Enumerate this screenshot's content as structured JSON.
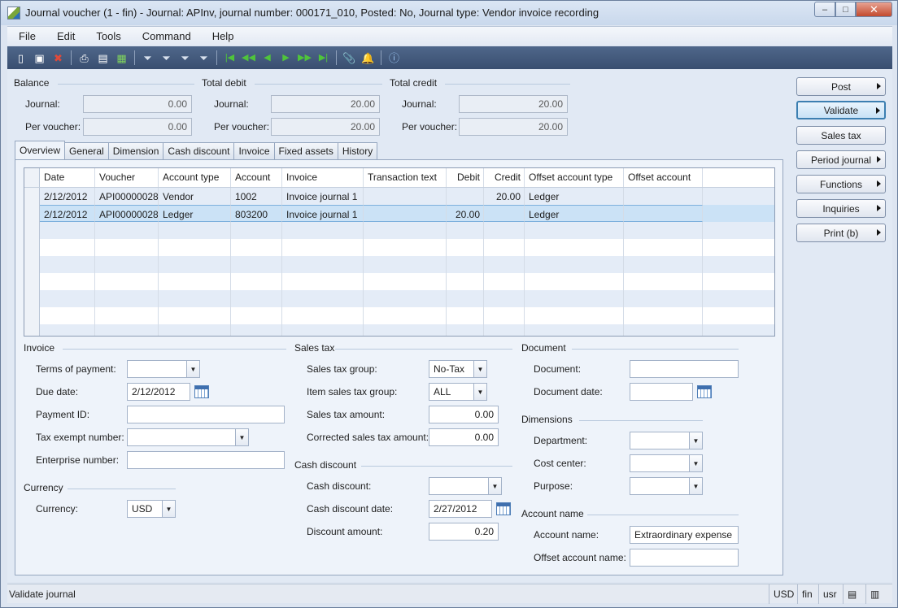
{
  "window": {
    "title": "Journal voucher (1 - fin) - Journal: APInv, journal number: 000171_010, Posted: No, Journal type: Vendor invoice recording",
    "min": "–",
    "max": "□",
    "close": "✕"
  },
  "menu": [
    "File",
    "Edit",
    "Tools",
    "Command",
    "Help"
  ],
  "toolbar_icons": [
    "new-icon",
    "save-icon",
    "delete-icon",
    "print-icon",
    "print-preview-icon",
    "export-excel-icon",
    "filter-by-selection-icon",
    "filter-by-form-icon",
    "advanced-filter-icon",
    "remove-filter-icon",
    "first-record-icon",
    "previous-page-icon",
    "previous-record-icon",
    "next-record-icon",
    "next-page-icon",
    "last-record-icon",
    "document-handling-icon",
    "alert-icon",
    "help-icon"
  ],
  "balance": {
    "balance_head": "Balance",
    "debit_head": "Total debit",
    "credit_head": "Total credit",
    "journal_label": "Journal:",
    "voucher_label": "Per voucher:",
    "balance_journal": "0.00",
    "balance_voucher": "0.00",
    "debit_journal": "20.00",
    "debit_voucher": "20.00",
    "credit_journal": "20.00",
    "credit_voucher": "20.00"
  },
  "tabs": [
    "Overview",
    "General",
    "Dimension",
    "Cash discount",
    "Invoice",
    "Fixed assets",
    "History"
  ],
  "active_tab": "Overview",
  "grid": {
    "columns": [
      "Date",
      "Voucher",
      "Account type",
      "Account",
      "Invoice",
      "Transaction text",
      "Debit",
      "Credit",
      "Offset account type",
      "Offset account"
    ],
    "rows": [
      {
        "date": "2/12/2012",
        "voucher": "API00000028",
        "account_type": "Vendor",
        "account": "1002",
        "invoice": "Invoice journal 1",
        "text": "",
        "debit": "",
        "credit": "20.00",
        "offset_type": "Ledger",
        "offset_account": ""
      },
      {
        "date": "2/12/2012",
        "voucher": "API00000028",
        "account_type": "Ledger",
        "account": "803200",
        "invoice": "Invoice journal 1",
        "text": "",
        "debit": "20.00",
        "credit": "",
        "offset_type": "Ledger",
        "offset_account": ""
      }
    ]
  },
  "invoice": {
    "head": "Invoice",
    "terms_label": "Terms of payment:",
    "terms_value": "",
    "due_label": "Due date:",
    "due_value": "2/12/2012",
    "payment_id_label": "Payment ID:",
    "payment_id_value": "",
    "tax_exempt_label": "Tax exempt number:",
    "tax_exempt_value": "",
    "enterprise_label": "Enterprise number:",
    "enterprise_value": ""
  },
  "currency": {
    "head": "Currency",
    "label": "Currency:",
    "value": "USD"
  },
  "sales_tax": {
    "head": "Sales tax",
    "group_label": "Sales tax group:",
    "group_value": "No-Tax",
    "item_group_label": "Item sales tax group:",
    "item_group_value": "ALL",
    "amount_label": "Sales tax amount:",
    "amount_value": "0.00",
    "corrected_label": "Corrected sales tax amount:",
    "corrected_value": "0.00"
  },
  "cash_discount": {
    "head": "Cash discount",
    "label": "Cash discount:",
    "value": "",
    "date_label": "Cash discount date:",
    "date_value": "2/27/2012",
    "amount_label": "Discount amount:",
    "amount_value": "0.20"
  },
  "document": {
    "head": "Document",
    "label": "Document:",
    "value": "",
    "date_label": "Document date:",
    "date_value": ""
  },
  "dimensions": {
    "head": "Dimensions",
    "department_label": "Department:",
    "department_value": "",
    "cost_center_label": "Cost center:",
    "cost_center_value": "",
    "purpose_label": "Purpose:",
    "purpose_value": ""
  },
  "account_name": {
    "head": "Account name",
    "label": "Account name:",
    "value": "Extraordinary expense",
    "offset_label": "Offset account name:",
    "offset_value": ""
  },
  "buttons": {
    "post": "Post",
    "validate": "Validate",
    "sales_tax": "Sales tax",
    "period_journal": "Period journal",
    "functions": "Functions",
    "inquiries": "Inquiries",
    "print": "Print (b)"
  },
  "status": {
    "text": "Validate journal",
    "currency": "USD",
    "company": "fin",
    "layer": "usr"
  }
}
